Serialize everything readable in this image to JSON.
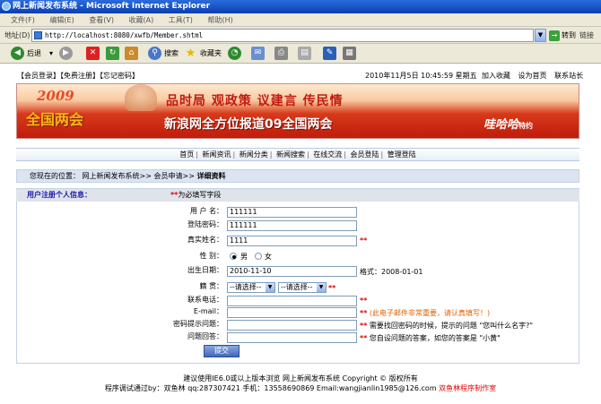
{
  "window": {
    "title": "网上新闻发布系统 - Microsoft Internet Explorer"
  },
  "menu": [
    "文件(F)",
    "编辑(E)",
    "查看(V)",
    "收藏(A)",
    "工具(T)",
    "帮助(H)"
  ],
  "address": {
    "label": "地址(D)",
    "url": "http://localhost:8080/xwfb/Member.shtml",
    "go": "转到",
    "links": "链接"
  },
  "toolbar": {
    "back": "后退",
    "search": "搜索",
    "favorites": "收藏夹"
  },
  "top": {
    "login_links": "【会员登录】【免费注册】【忘记密码】",
    "datetime": "2010年11月5日  10:45:59    星期五",
    "links": [
      "加入收藏",
      "设为首页",
      "联系站长"
    ]
  },
  "banner": {
    "year": "2009",
    "event": "全国两会",
    "slogan": "品时局 观政策 议建言 传民情",
    "sub": "新浪网全方位报道09全国两会",
    "special": "哇哈哈",
    "special_suffix": "特约"
  },
  "nav": [
    "首页",
    "新闻资讯",
    "新闻分类",
    "新闻搜索",
    "在线交流",
    "会员登陆",
    "管理登陆"
  ],
  "location": {
    "prefix": "您现在的位置：",
    "path": "网上新闻发布系统>> 会员申请>>",
    "current": "详细资料"
  },
  "form": {
    "heading": "用户注册个人信息：",
    "required_mark": "**",
    "required_note": "为必填写字段",
    "fields": {
      "username": {
        "label": "用 户 名：",
        "value": "111111"
      },
      "password": {
        "label": "登陆密码：",
        "value": "111111"
      },
      "realname": {
        "label": "真实姓名：",
        "value": "1111"
      },
      "gender": {
        "label": "性    别：",
        "male": "男",
        "female": "女"
      },
      "birthday": {
        "label": "出生日期：",
        "value": "2010-11-10",
        "hint": "格式：2008-01-01"
      },
      "native": {
        "label": "籍    贯：",
        "select1": "--请选择--",
        "select2": "--请选择--"
      },
      "phone": {
        "label": "联系电话：",
        "value": ""
      },
      "email": {
        "label": "E-mail：",
        "value": "",
        "note": "(此电子邮件非常重要，请认真填写！)"
      },
      "question": {
        "label": "密码提示问题：",
        "value": "",
        "note": "需要找回密码的时候，提示的问题 \"您叫什么名字?\""
      },
      "answer": {
        "label": "问题回答：",
        "value": "",
        "note": "您自设问题的答案，如您的答案是 \"小黄\""
      }
    },
    "submit": "提交"
  },
  "footer": {
    "line1": "建议使用IE6.0或以上版本浏览  网上新闻发布系统 Copyright © 版权所有",
    "line2": "程序调试通过by：双鱼林 qq:287307421 手机：13558690869 Email:wangjianlin1985@126.com",
    "studio": "双鱼林程序制作室"
  },
  "colors": {
    "title_bar": "#0a3fb0",
    "chrome": "#ece9d8",
    "required": "#e00000",
    "heading_blue": "#1a1aa8",
    "location_bg": "#dbe5f1"
  }
}
